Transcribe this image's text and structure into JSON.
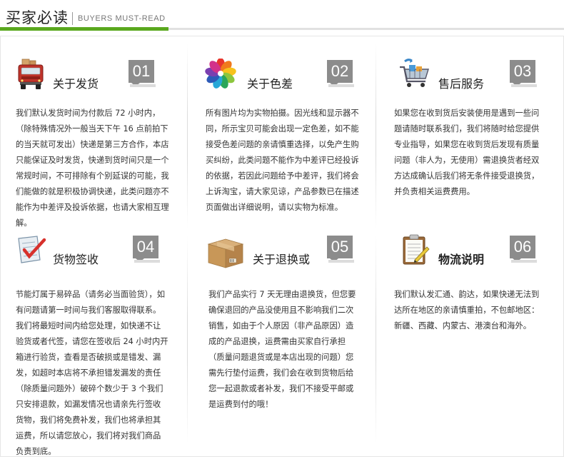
{
  "header": {
    "title": "买家必读",
    "subtitle": "BUYERS MUST-READ"
  },
  "sections": [
    {
      "number": "01",
      "title": "关于发货",
      "icon": "truck-icon",
      "text": "我们默认发货时间为付款后 72 小时内，（除特殊情况外一般当天下午 16 点前拍下的当天就可发出）快递是第三方合作，本店只能保证及时发货，快递到货时间只是一个常规时间，不可排除有个别延误的可能，我们能做的就是积极协调快递，此类问题亦不能作为中差评及投诉依据，也请大家相互理解。"
    },
    {
      "number": "02",
      "title": "关于色差",
      "icon": "color-wheel-icon",
      "text": "所有图片均为实物拍摄。因光线和显示器不同，所示宝贝可能会出现一定色差，如不能接受色差问题的亲请慎重选择，以免产生购买纠纷，此类问题不能作为中差评已经投诉的依据，若因此问题给予中差评，我们将会上诉淘宝，请大家见谅，产品参数已在描述页面做出详细说明，请以实物为标准。"
    },
    {
      "number": "03",
      "title": "售后服务",
      "icon": "shopping-cart-icon",
      "text": "如果您在收到货后安装使用是遇到一些问题请随时联系我们，我们将随时给您提供专业指导，如果您在收到货后发现有质量问题（非人为，无使用）需退换货者经双方达成确认后我们将无条件接受退换货，并负责相关运费费用。"
    },
    {
      "number": "04",
      "title": "货物签收",
      "icon": "checklist-icon",
      "text": "节能灯属于易碎品（请务必当面验货），如有问题请第一时间与我们客服取得联系。我们将最短时间内给您处理，如快递不让验货或者代签，请您在签收后 24 小时内开箱进行验货，查看是否破损或是错发、漏发，如超时本店将不承担错发漏发的责任（除质量问题外）破碎个数少于 3 个我们只安排退款，如漏发情况也请亲先行签收货物，我们将免费补发，我们也将承担其运费，所以请您放心，我们将对我们商品负责到底。"
    },
    {
      "number": "05",
      "title": "关于退换或",
      "icon": "cardboard-box-icon",
      "text": "我们产品实行 7 天无理由退换货，但您要确保退回的产品没使用且不影响我们二次销售，如由于个人原因（非产品原因）造成的产品退换，运费需由买家自行承担（质量问题退货或是本店出现的问题）您需先行垫付运费，我们会在收到货物后给您一起退款或者补发，我们不接受平邮或是运费到付的哦！"
    },
    {
      "number": "06",
      "title": "物流说明",
      "icon": "clipboard-icon",
      "text": "我们默认发汇通、韵达，如果快递无法到达所在地区的亲请慎重拍，不包邮地区：新疆、西藏、内蒙古、港澳台和海外。"
    }
  ]
}
